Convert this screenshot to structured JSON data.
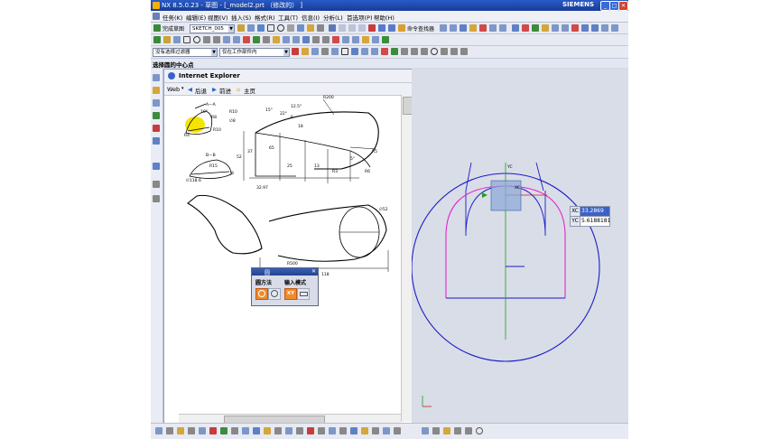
{
  "window": {
    "title": "NX 8.5.0.23 - 草图 - [_model2.prt （修改的） ]",
    "brand": "SIEMENS",
    "min": "_",
    "max": "□",
    "close": "✕"
  },
  "menu": [
    "任务(K)",
    "编辑(E)",
    "视图(V)",
    "插入(S)",
    "格式(R)",
    "工具(T)",
    "信息(I)",
    "分析(L)",
    "首选项(P)",
    "帮助(H)"
  ],
  "toolbar1": {
    "finish_sketch": "完成草图",
    "sketch_name": "SKETCH_005",
    "command_finder": "命令查找器"
  },
  "toolbar2": {
    "selection_filter": "没有选择过滤器",
    "scope": "仅在工作部件内"
  },
  "prompt": "选择圆的中心点",
  "browser": {
    "title": "Internet Explorer",
    "web": "Web",
    "back": "后退",
    "forward": "前进",
    "home": "主页"
  },
  "drawing": {
    "sec_a": "A—A",
    "sec_b": "B—B",
    "r8": "R8",
    "r15": "R15",
    "r10": "R10",
    "r4": "R4",
    "phi8": "∅8",
    "r200": "R200",
    "dim_52": "52",
    "dim_37": "37",
    "dim_25": "25",
    "dim_13": "13",
    "r3": "R3",
    "r5": "R5",
    "r6": "R6",
    "angle_15": "15°",
    "angle_10": "10°",
    "angle_125": "12.5°",
    "angle_22": "22°",
    "angle_5": "5°",
    "dim_18": "18",
    "dim_65": "65",
    "dim_3297": "32.97",
    "dim_118": "118",
    "dim_phi52": "∅52",
    "r500": "R500",
    "dim_6": "6",
    "dim_8": "8",
    "r10b": "R10",
    "dim_118b": "∅118.6"
  },
  "circle_dialog": {
    "title": "圆",
    "method_label": "圆方法",
    "input_label": "输入模式",
    "xy": "XY"
  },
  "dynamic_input": {
    "xc_label": "XC",
    "xc_value": "33.2869",
    "yc_label": "YC",
    "yc_value": "5.6188181"
  },
  "viewport": {
    "x_axis": "XC",
    "y_axis": "YC"
  },
  "colors": {
    "titlebar": "#1f4bb0",
    "circle": "#1c1cc8",
    "profile": "#e028c8",
    "axis_x": "#c81c1c",
    "axis_y": "#1ca01c",
    "viewport_bg": "#d9dde7",
    "highlight": "#f4e400"
  }
}
